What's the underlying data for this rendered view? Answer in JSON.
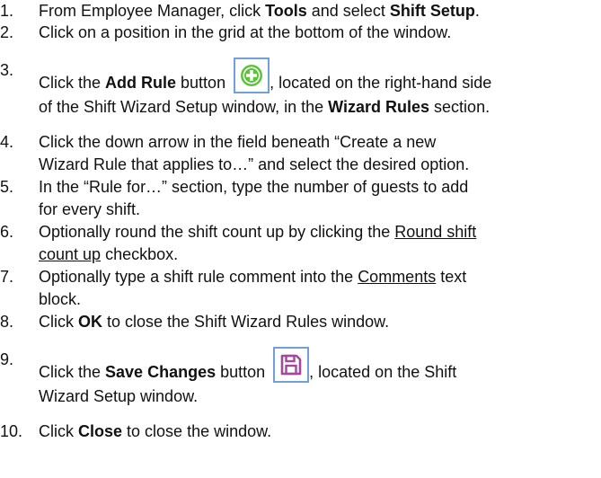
{
  "steps": [
    {
      "num": "1.",
      "t1": "From Employee Manager, click ",
      "b1": "Tools",
      "t2": " and select ",
      "b2": "Shift Setup",
      "t3": "."
    },
    {
      "num": "2.",
      "t1": "Click on a position in the grid at the bottom of the window."
    },
    {
      "num": "3.",
      "t1": "Click the ",
      "b1": "Add Rule",
      "t2": " button ",
      "t3": ", located on the right-hand side",
      "l2a": "of the Shift Wizard Setup window, in the ",
      "l2b": "Wizard Rules",
      "l2c": " section."
    },
    {
      "num": "4.",
      "l1": "Click the down arrow in the field beneath “Create a new",
      "l2": "Wizard Rule that applies to…” and select the desired option."
    },
    {
      "num": "5.",
      "l1": "In the “Rule for…” section, type the number of guests to add",
      "l2": "for every shift."
    },
    {
      "num": "6.",
      "t1": "Optionally round the shift count up by clicking the ",
      "u1": "Round shift",
      "u2": "count up",
      "t2": " checkbox."
    },
    {
      "num": "7.",
      "t1": "Optionally type a shift rule comment into the ",
      "u1": "Comments",
      "t2": " text",
      "l2": "block."
    },
    {
      "num": "8.",
      "t1": "Click ",
      "b1": "OK",
      "t2": " to close the Shift Wizard Rules window."
    },
    {
      "num": "9.",
      "t1": "Click the ",
      "b1": "Save Changes",
      "t2": " button ",
      "t3": ", located on the Shift",
      "l2": "Wizard Setup window."
    },
    {
      "num": "10.",
      "t1": "Click ",
      "b1": "Close",
      "t2": " to close the window."
    }
  ],
  "icons": {
    "add_rule": "plus-circle-icon",
    "save_changes": "save-disk-icon",
    "icon_border_color": "#6fa0d8",
    "add_color": "#5cc43c",
    "save_color": "#a14a9c"
  }
}
